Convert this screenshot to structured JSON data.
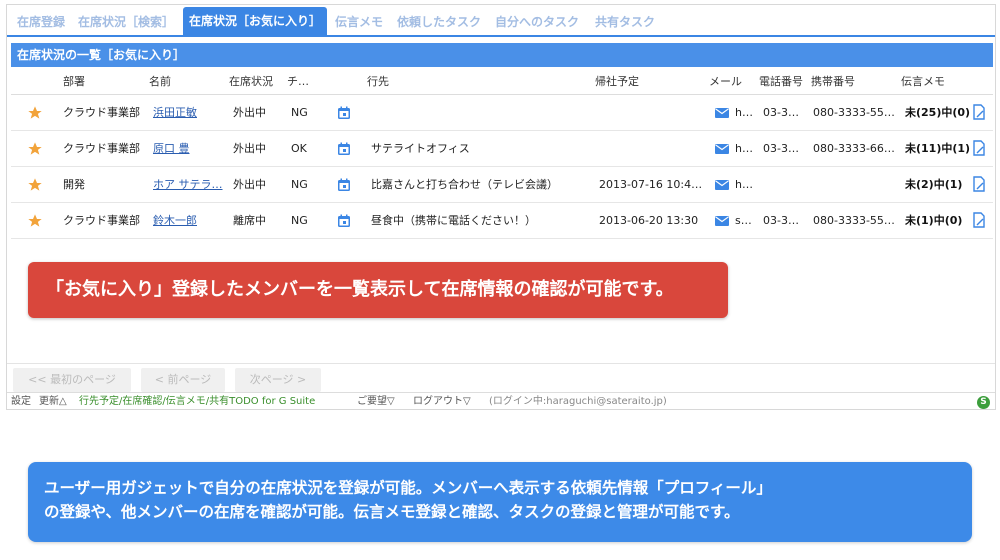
{
  "tabs": [
    {
      "label": "在席登録"
    },
    {
      "label": "在席状況［検索］"
    },
    {
      "label": "在席状況［お気に入り］"
    },
    {
      "label": "伝言メモ"
    },
    {
      "label": "依頼したタスク"
    },
    {
      "label": "自分へのタスク"
    },
    {
      "label": "共有タスク"
    }
  ],
  "list_title": "在席状況の一覧［お気に入り］",
  "columns": {
    "dept": "部署",
    "name": "名前",
    "status": "在席状況",
    "check": "チ…",
    "dest": "行先",
    "return": "帰社予定",
    "mail": "メール",
    "phone": "電話番号",
    "mobile": "携帯番号",
    "memo": "伝言メモ"
  },
  "rows": [
    {
      "dept": "クラウド事業部",
      "name": "浜田正敏",
      "status": "外出中",
      "check": "NG",
      "dest": "",
      "return": "",
      "mail": "h…",
      "phone": "03-3…",
      "mobile": "080-3333-55…",
      "memo": "未(25)中(0)"
    },
    {
      "dept": "クラウド事業部",
      "name": "原口 豊",
      "status": "外出中",
      "check": "OK",
      "dest": "サテライトオフィス",
      "return": "",
      "mail": "h…",
      "phone": "03-3…",
      "mobile": "080-3333-66…",
      "memo": "未(11)中(1)"
    },
    {
      "dept": "開発",
      "name": "ホア サテラ…",
      "status": "外出中",
      "check": "NG",
      "dest": "比嘉さんと打ち合わせ（テレビ会議）",
      "return": "2013-07-16 10:4…",
      "mail": "h…",
      "phone": "",
      "mobile": "",
      "memo": "未(2)中(1)"
    },
    {
      "dept": "クラウド事業部",
      "name": "鈴木一郎",
      "status": "離席中",
      "check": "NG",
      "dest": "昼食中（携帯に電話ください！）",
      "return": "2013-06-20 13:30",
      "mail": "s…",
      "phone": "03-3…",
      "mobile": "080-3333-55…",
      "memo": "未(1)中(0)"
    }
  ],
  "callout_red": "「お気に入り」登録したメンバーを一覧表示して在席情報の確認が可能です。",
  "pager": {
    "first": "<< 最初のページ",
    "prev": "< 前ページ",
    "next": "次ページ >"
  },
  "status_bar": {
    "settings": "設定",
    "update": "更新△",
    "app": "行先予定/在席確認/伝言メモ/共有TODO for G Suite",
    "request": "ご要望▽",
    "logout": "ログアウト▽",
    "login": "(ログイン中:haraguchi@sateraito.jp)",
    "icon_letter": "S"
  },
  "callout_blue": {
    "line1": "ユーザー用ガジェットで自分の在席状況を登録が可能。メンバーへ表示する依頼先情報「プロフィール」",
    "line2": "の登録や、他メンバーの在席を確認が可能。伝言メモ登録と確認、タスクの登録と管理が可能です。"
  },
  "colors": {
    "accent": "#3b86e4",
    "star": "#f2a33a",
    "red_callout": "#d9473c",
    "blue_callout": "#3d8ae8",
    "status_green": "#3a8f2c"
  }
}
